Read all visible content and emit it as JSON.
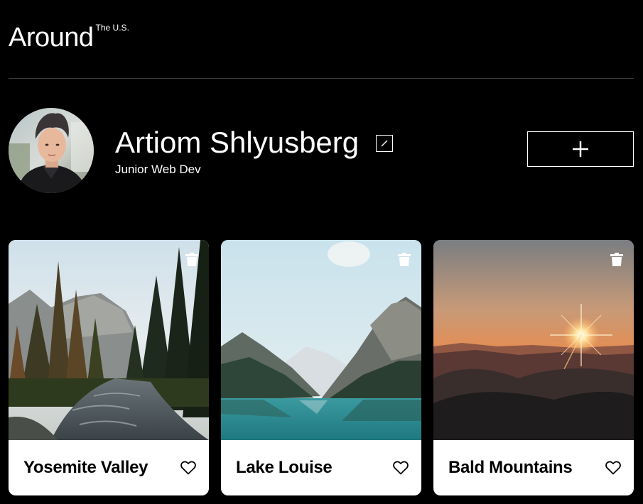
{
  "header": {
    "logo_main": "Around",
    "logo_sup": "The U.S."
  },
  "profile": {
    "name": "Artiom Shlyusberg",
    "job": "Junior Web Dev",
    "edit_icon": "pencil-icon",
    "add_icon": "plus-icon"
  },
  "cards": [
    {
      "title": "Yosemite Valley",
      "like_icon": "heart-outline-icon",
      "delete_icon": "trash-icon"
    },
    {
      "title": "Lake Louise",
      "like_icon": "heart-outline-icon",
      "delete_icon": "trash-icon"
    },
    {
      "title": "Bald Mountains",
      "like_icon": "heart-outline-icon",
      "delete_icon": "trash-icon"
    }
  ],
  "colors": {
    "background": "#000000",
    "text": "#ffffff",
    "card": "#ffffff",
    "card_text": "#000000"
  }
}
